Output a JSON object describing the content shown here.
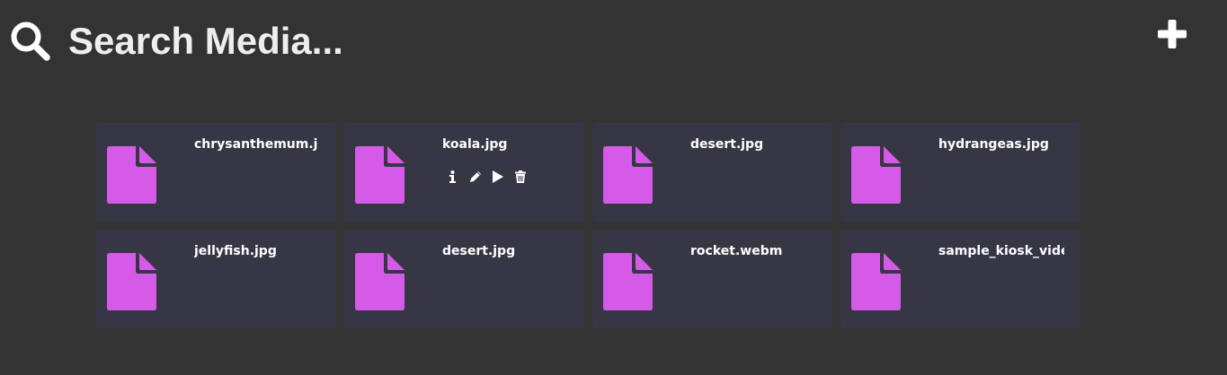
{
  "search": {
    "placeholder": "Search Media...",
    "icon": "search-icon"
  },
  "add_button": {
    "icon": "plus-icon"
  },
  "colors": {
    "background": "#333333",
    "card": "#373645",
    "file_icon": "#d65ae8",
    "text": "#ffffff"
  },
  "media": [
    {
      "name": "chrysanthemum.j",
      "icon": "file-icon"
    },
    {
      "name": "koala.jpg",
      "icon": "file-icon",
      "actions": [
        "info-icon",
        "pencil-icon",
        "play-icon",
        "trash-icon"
      ]
    },
    {
      "name": "desert.jpg",
      "icon": "file-icon"
    },
    {
      "name": "hydrangeas.jpg",
      "icon": "file-icon"
    },
    {
      "name": "jellyfish.jpg",
      "icon": "file-icon"
    },
    {
      "name": "desert.jpg",
      "icon": "file-icon"
    },
    {
      "name": "rocket.webm",
      "icon": "file-icon"
    },
    {
      "name": "sample_kiosk_vide",
      "icon": "file-icon"
    }
  ]
}
